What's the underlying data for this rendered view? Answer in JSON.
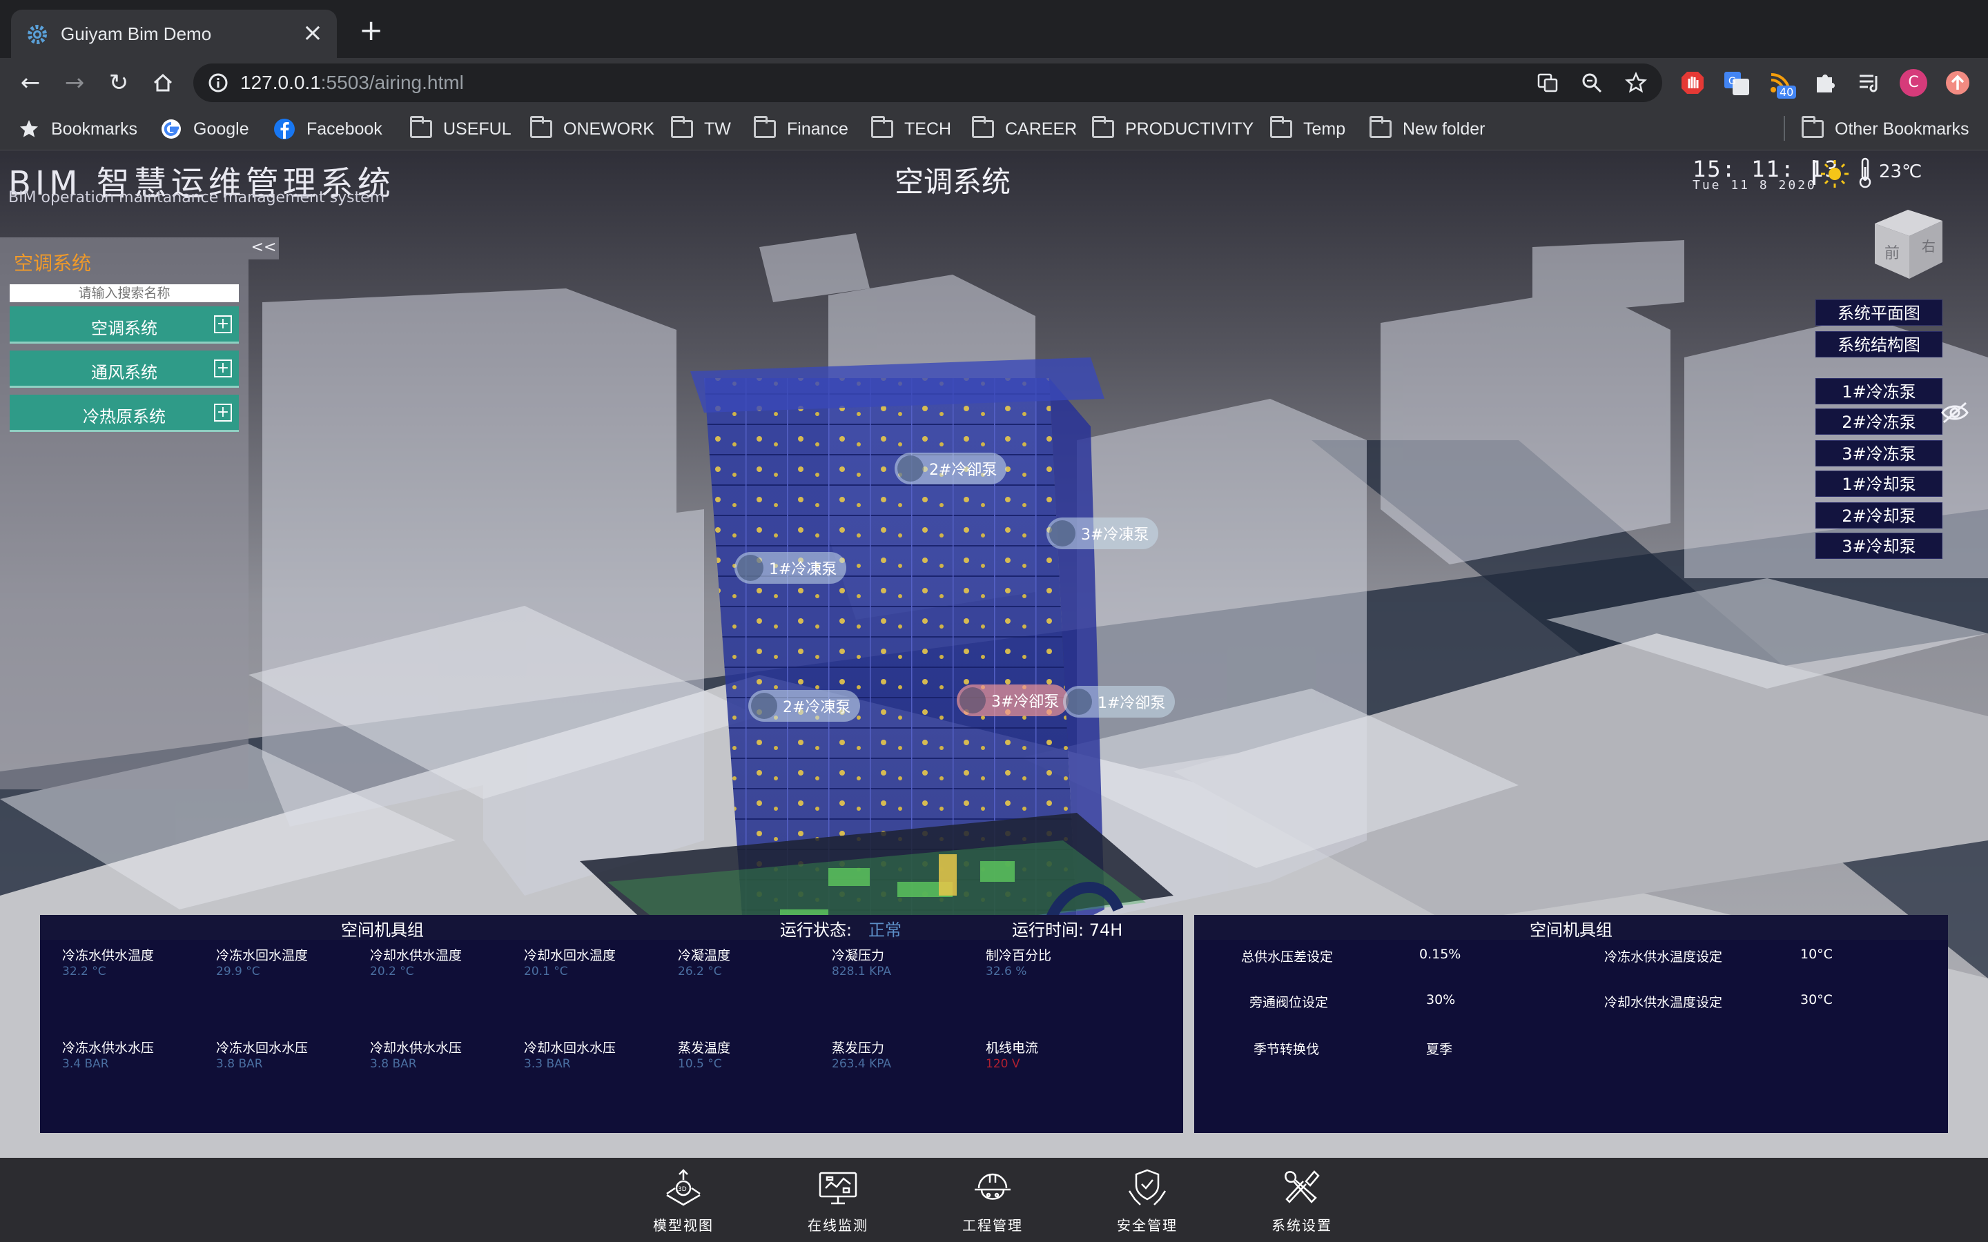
{
  "browser": {
    "tab_title": "Guiyam Bim Demo",
    "url_host": "127.0.0.1",
    "url_rest": ":5503/airing.html",
    "profile_initial": "C",
    "ext_badge": "40",
    "bookmarks": [
      "Bookmarks",
      "Google",
      "Facebook",
      "USEFUL",
      "ONEWORK",
      "TW",
      "Finance",
      "TECH",
      "CAREER",
      "PRODUCTIVITY",
      "Temp",
      "New folder"
    ],
    "other_bookmarks": "Other Bookmarks"
  },
  "header": {
    "app_title": "BIM 智慧运维管理系统",
    "app_subtitle": "BIM operation maintanance management system",
    "page_title": "空调系统",
    "time": "15: 11: 13",
    "date": "Tue 11 8 2020",
    "temperature": "23℃"
  },
  "viewcube": {
    "front": "前",
    "right": "右"
  },
  "left_panel": {
    "title": "空调系统",
    "collapse": "<<",
    "search_placeholder": "请输入搜索名称",
    "systems": [
      "空调系统",
      "通风系统",
      "冷热原系统"
    ],
    "expand": "+"
  },
  "right_menu": {
    "views": [
      "系统平面图",
      "系统结构图"
    ],
    "pumps": [
      "1#冷冻泵",
      "2#冷冻泵",
      "3#冷冻泵",
      "1#冷却泵",
      "2#冷却泵",
      "3#冷却泵"
    ]
  },
  "markers": [
    {
      "label": "2#冷卻泵",
      "alarm": false
    },
    {
      "label": "3#冷凍泵",
      "alarm": false
    },
    {
      "label": "1#冷凍泵",
      "alarm": false
    },
    {
      "label": "2#冷凍泵",
      "alarm": false
    },
    {
      "label": "3#冷卻泵",
      "alarm": true
    },
    {
      "label": "1#冷卻泵",
      "alarm": false
    }
  ],
  "unit_panel": {
    "title": "空间机具组",
    "status_label": "运行状态:",
    "status_value": "正常",
    "runtime": "运行时间: 74H",
    "metrics_row1": [
      {
        "label": "冷冻水供水温度",
        "value": "32.2 °C"
      },
      {
        "label": "冷冻水回水温度",
        "value": "29.9 °C"
      },
      {
        "label": "冷却水供水温度",
        "value": "20.2 °C"
      },
      {
        "label": "冷却水回水温度",
        "value": "20.1 °C"
      },
      {
        "label": "冷凝温度",
        "value": "26.2 °C"
      },
      {
        "label": "冷凝压力",
        "value": "828.1 KPA"
      },
      {
        "label": "制冷百分比",
        "value": "32.6 %"
      }
    ],
    "metrics_row2": [
      {
        "label": "冷冻水供水水压",
        "value": "3.4 BAR"
      },
      {
        "label": "冷冻水回水水压",
        "value": "3.8 BAR"
      },
      {
        "label": "冷却水供水水压",
        "value": "3.8 BAR"
      },
      {
        "label": "冷却水回水水压",
        "value": "3.3 BAR"
      },
      {
        "label": "蒸发温度",
        "value": "10.5 °C"
      },
      {
        "label": "蒸发压力",
        "value": "263.4 KPA"
      },
      {
        "label": "机线电流",
        "value": "120 V",
        "alert": true
      }
    ]
  },
  "settings_panel": {
    "title": "空间机具组",
    "rows": [
      {
        "label": "总供水压差设定",
        "value": "0.15%",
        "label2": "冷冻水供水温度设定",
        "value2": "10°C"
      },
      {
        "label": "旁通阀位设定",
        "value": "30%",
        "label2": "冷却水供水温度设定",
        "value2": "30°C"
      },
      {
        "label": "季节转换伐",
        "value": "夏季",
        "label2": "",
        "value2": ""
      }
    ]
  },
  "bottom_nav": [
    "模型视图",
    "在线监测",
    "工程管理",
    "安全管理",
    "系统设置"
  ],
  "colors": {
    "accent_orange": "#f09a2a",
    "menu_teal": "#2f9b88",
    "panel_navy": "#0f0e37",
    "status_blue": "#5d90c8",
    "alert_red": "#b02030"
  }
}
